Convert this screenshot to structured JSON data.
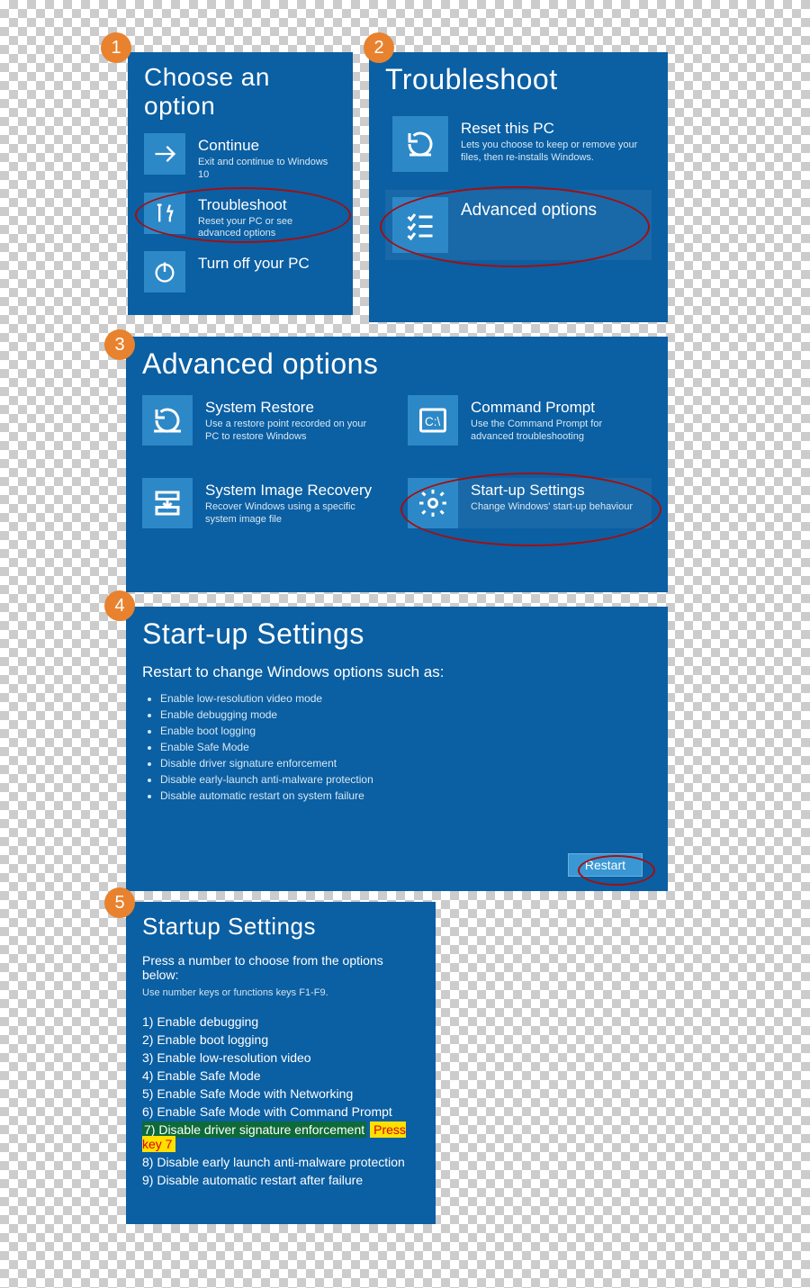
{
  "panel1": {
    "title": "Choose an option",
    "items": [
      {
        "title": "Continue",
        "sub": "Exit and continue to Windows 10"
      },
      {
        "title": "Troubleshoot",
        "sub": "Reset your PC or see advanced options"
      },
      {
        "title": "Turn off your PC",
        "sub": ""
      }
    ]
  },
  "panel2": {
    "title": "Troubleshoot",
    "items": [
      {
        "title": "Reset this PC",
        "sub": "Lets you choose to keep or remove your files, then re-installs Windows."
      },
      {
        "title": "Advanced options",
        "sub": ""
      }
    ]
  },
  "panel3": {
    "title": "Advanced options",
    "items": [
      {
        "title": "System Restore",
        "sub": "Use a restore point recorded on your PC to restore Windows"
      },
      {
        "title": "Command Prompt",
        "sub": "Use the Command Prompt for advanced troubleshooting"
      },
      {
        "title": "System Image Recovery",
        "sub": "Recover Windows using a specific system image file"
      },
      {
        "title": "Start-up Settings",
        "sub": "Change Windows' start-up behaviour"
      }
    ]
  },
  "panel4": {
    "title": "Start-up Settings",
    "sub": "Restart to change Windows options such as:",
    "items": [
      "Enable low-resolution video mode",
      "Enable debugging mode",
      "Enable boot logging",
      "Enable Safe Mode",
      "Disable driver signature enforcement",
      "Disable early-launch anti-malware protection",
      "Disable automatic restart on system failure"
    ],
    "restart": "Restart"
  },
  "panel5": {
    "title": "Startup Settings",
    "sub": "Press a number to choose from the options below:",
    "hint": "Use number keys or functions keys F1-F9.",
    "items": [
      "1) Enable debugging",
      "2) Enable boot logging",
      "3) Enable low-resolution video",
      "4) Enable Safe Mode",
      "5) Enable Safe Mode with Networking",
      "6) Enable Safe Mode with Command Prompt",
      "7) Disable driver signature enforcement",
      "8) Disable early launch anti-malware protection",
      "9) Disable automatic restart after failure"
    ],
    "press": "Press key 7"
  },
  "badges": [
    "1",
    "2",
    "3",
    "4",
    "5"
  ]
}
